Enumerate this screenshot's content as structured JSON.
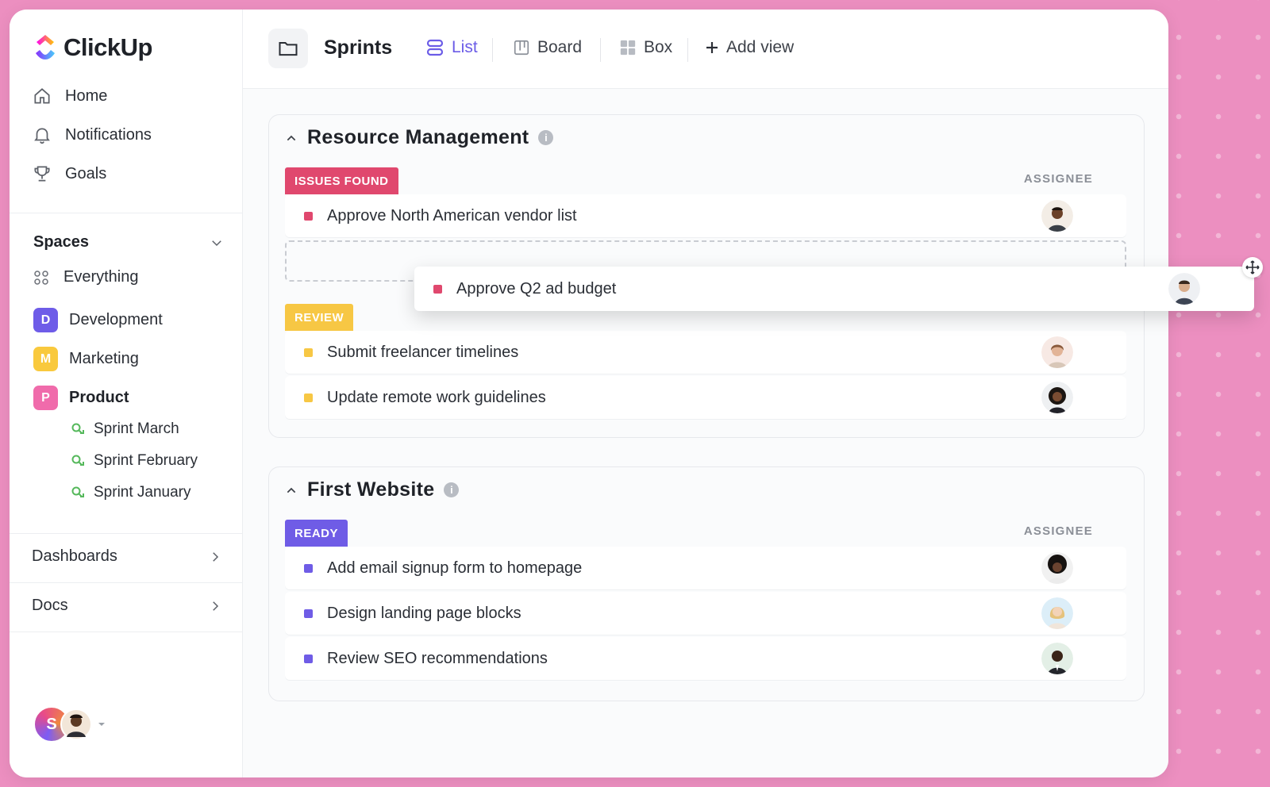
{
  "app": {
    "name": "ClickUp"
  },
  "sidebar": {
    "nav": [
      {
        "label": "Home",
        "icon": "home-icon"
      },
      {
        "label": "Notifications",
        "icon": "bell-icon"
      },
      {
        "label": "Goals",
        "icon": "trophy-icon"
      }
    ],
    "spaces_label": "Spaces",
    "everything_label": "Everything",
    "spaces": [
      {
        "badge": "D",
        "label": "Development",
        "color": "#6e5ce8"
      },
      {
        "badge": "M",
        "label": "Marketing",
        "color": "#f9c93d"
      },
      {
        "badge": "P",
        "label": "Product",
        "color": "#f06bab"
      }
    ],
    "sprints": [
      "Sprint  March",
      "Sprint  February",
      "Sprint January"
    ],
    "dashboards_label": "Dashboards",
    "docs_label": "Docs",
    "user_initial": "S"
  },
  "topbar": {
    "title": "Sprints",
    "views": [
      {
        "label": "List",
        "icon": "list-icon",
        "active": true
      },
      {
        "label": "Board",
        "icon": "board-icon",
        "active": false
      },
      {
        "label": "Box",
        "icon": "box-icon",
        "active": false
      }
    ],
    "add_view_label": "Add view"
  },
  "groups": [
    {
      "title": "Resource Management",
      "assignee_header": "ASSIGNEE",
      "statuses": [
        {
          "label": "ISSUES FOUND",
          "color": "#e0486e",
          "tasks": [
            "Approve North American vendor list"
          ]
        },
        {
          "label": "REVIEW",
          "color": "#f7c744",
          "tasks": [
            "Submit freelancer timelines",
            "Update remote work guidelines"
          ]
        }
      ]
    },
    {
      "title": "First Website",
      "assignee_header": "ASSIGNEE",
      "statuses": [
        {
          "label": "READY",
          "color": "#6f5ce6",
          "tasks": [
            "Add email signup form to homepage",
            "Design landing page blocks",
            "Review SEO recommendations"
          ]
        }
      ]
    }
  ],
  "dragging_task": {
    "label": "Approve Q2 ad budget",
    "color": "#e0486e"
  }
}
